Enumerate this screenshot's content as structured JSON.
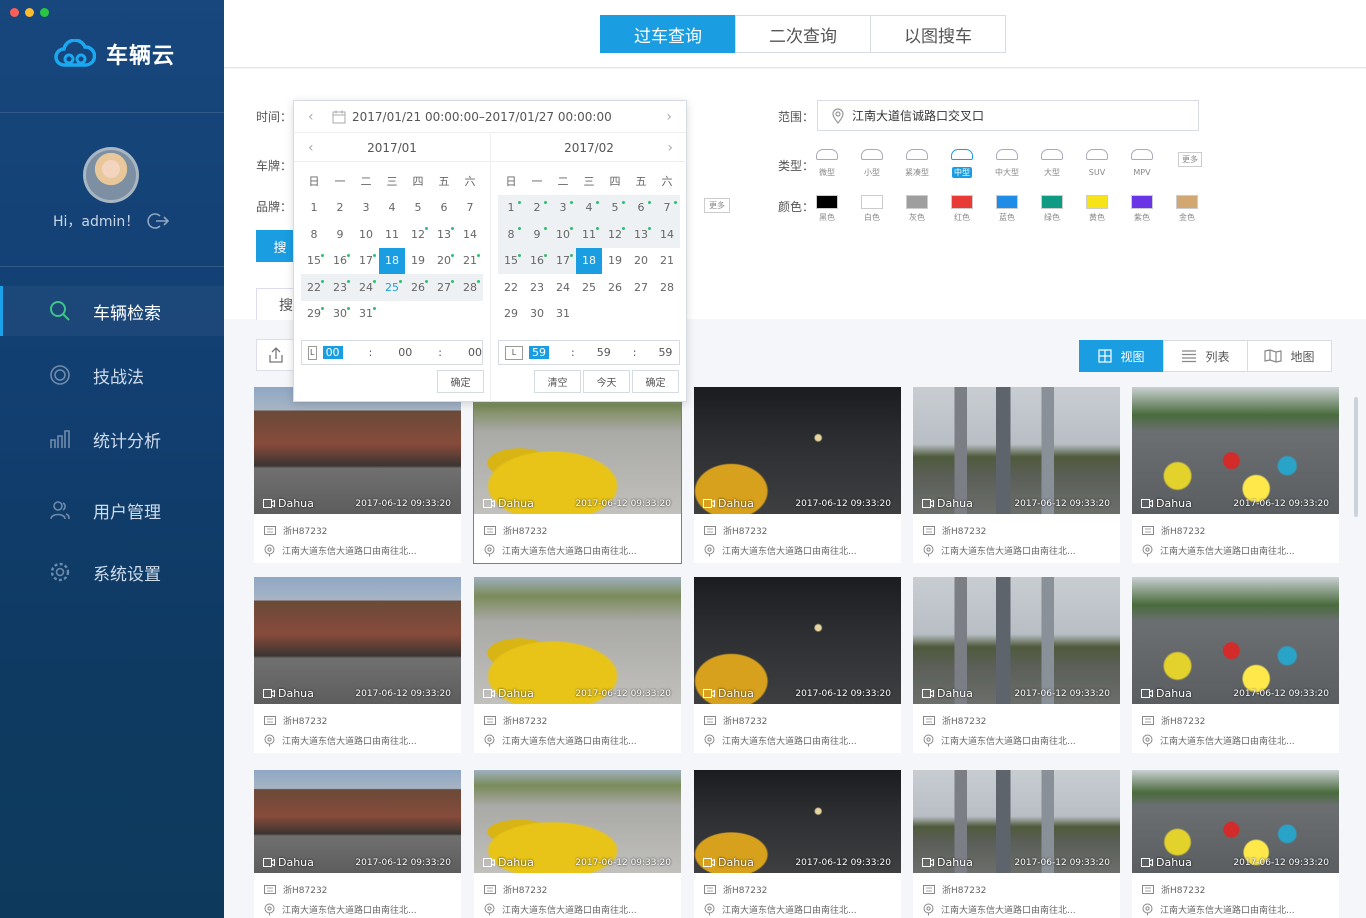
{
  "window": {
    "traffic_colors": [
      "#fc5f57",
      "#fdbc2e",
      "#28c840"
    ]
  },
  "app": {
    "logo_text": "车辆云"
  },
  "user": {
    "greeting": "Hi，admin！"
  },
  "sidebar": {
    "items": [
      {
        "label": "车辆检索",
        "icon": "search-icon",
        "active": true
      },
      {
        "label": "技战法",
        "icon": "target-icon",
        "active": false
      },
      {
        "label": "统计分析",
        "icon": "bar-chart-icon",
        "active": false
      },
      {
        "label": "用户管理",
        "icon": "users-icon",
        "active": false
      },
      {
        "label": "系统设置",
        "icon": "gear-icon",
        "active": false
      }
    ]
  },
  "top_tabs": [
    {
      "label": "过车查询",
      "active": true
    },
    {
      "label": "二次查询",
      "active": false
    },
    {
      "label": "以图搜车",
      "active": false
    }
  ],
  "filters": {
    "time_label": "时间：",
    "time_value": "2017/01/21 00:00:00–2017/01/27 00:00:00",
    "plate_label": "车牌：",
    "brand_label": "品牌：",
    "brand_more": "更多",
    "range_label": "范围：",
    "range_value": "江南大道信诚路口交叉口",
    "type_label": "类型：",
    "types": [
      "微型",
      "小型",
      "紧凑型",
      "中型",
      "中大型",
      "大型",
      "SUV",
      "MPV"
    ],
    "selected_type": "中型",
    "type_more": "更多",
    "color_label": "颜色：",
    "colors": [
      {
        "name": "黑色",
        "hex": "#000000"
      },
      {
        "name": "白色",
        "hex": "#ffffff"
      },
      {
        "name": "灰色",
        "hex": "#9e9e9e"
      },
      {
        "name": "红色",
        "hex": "#e83b35"
      },
      {
        "name": "蓝色",
        "hex": "#1f8de8"
      },
      {
        "name": "绿色",
        "hex": "#0f9a84"
      },
      {
        "name": "黄色",
        "hex": "#f7e31a"
      },
      {
        "name": "紫色",
        "hex": "#6a35e6"
      },
      {
        "name": "金色",
        "hex": "#d2a872"
      }
    ],
    "search_button": "搜",
    "sub_tab": "搜"
  },
  "view_tabs": [
    {
      "label": "视图",
      "icon": "grid-view-icon",
      "active": true
    },
    {
      "label": "列表",
      "icon": "list-view-icon",
      "active": false
    },
    {
      "label": "地图",
      "icon": "map-view-icon",
      "active": false
    }
  ],
  "datepicker": {
    "weekdays": [
      "日",
      "一",
      "二",
      "三",
      "四",
      "五",
      "六"
    ],
    "left": {
      "month": "2017/01",
      "days": [
        "1",
        "2",
        "3",
        "4",
        "5",
        "6",
        "7",
        "8",
        "9",
        "10",
        "11",
        "12",
        "13",
        "14",
        "15",
        "16",
        "17",
        "18",
        "19",
        "20",
        "21",
        "22",
        "23",
        "24",
        "25",
        "26",
        "27",
        "28",
        "29",
        "30",
        "31"
      ],
      "offset": 0,
      "selected": "18",
      "in_range": [
        "22",
        "23",
        "24",
        "25",
        "26",
        "27",
        "28"
      ],
      "dots": [
        "12",
        "13",
        "15",
        "16",
        "17",
        "20",
        "21",
        "22",
        "23",
        "24",
        "25",
        "26",
        "27",
        "28",
        "29",
        "30",
        "31"
      ],
      "today": "25",
      "time": {
        "h": "00",
        "m": "00",
        "s": "00"
      },
      "confirm": "确定"
    },
    "right": {
      "month": "2017/02",
      "days": [
        "1",
        "2",
        "3",
        "4",
        "5",
        "6",
        "7",
        "8",
        "9",
        "10",
        "11",
        "12",
        "13",
        "14",
        "15",
        "16",
        "17",
        "18",
        "19",
        "20",
        "21",
        "22",
        "23",
        "24",
        "25",
        "26",
        "27",
        "28",
        "29",
        "30",
        "31"
      ],
      "offset": 0,
      "selected": "18",
      "in_range": [
        "1",
        "2",
        "3",
        "4",
        "5",
        "6",
        "7",
        "8",
        "9",
        "10",
        "11",
        "12",
        "13",
        "14",
        "15",
        "16",
        "17"
      ],
      "dots": [
        "1",
        "2",
        "3",
        "4",
        "5",
        "6",
        "7",
        "8",
        "9",
        "10",
        "11",
        "12",
        "13",
        "15",
        "16",
        "17"
      ],
      "time": {
        "h": "59",
        "m": "59",
        "s": "59"
      },
      "clear": "清空",
      "today_btn": "今天",
      "confirm": "确定"
    }
  },
  "results": [
    {
      "brand": "Dahua",
      "time": "2017-06-12 09:33:20",
      "plate": "浙H87232",
      "location": "江南大道东信大道路口由南往北...",
      "scene": "street"
    },
    {
      "brand": "Dahua",
      "time": "2017-06-12 09:33:20",
      "plate": "浙H87232",
      "location": "江南大道东信大道路口由南往北...",
      "scene": "taxi"
    },
    {
      "brand": "Dahua",
      "time": "2017-06-12 09:33:20",
      "plate": "浙H87232",
      "location": "江南大道东信大道路口由南往北...",
      "scene": "night"
    },
    {
      "brand": "Dahua",
      "time": "2017-06-12 09:33:20",
      "plate": "浙H87232",
      "location": "江南大道东信大道路口由南往北...",
      "scene": "city"
    },
    {
      "brand": "Dahua",
      "time": "2017-06-12 09:33:20",
      "plate": "浙H87232",
      "location": "江南大道东信大道路口由南往北...",
      "scene": "traffic"
    },
    {
      "brand": "Dahua",
      "time": "2017-06-12 09:33:20",
      "plate": "浙H87232",
      "location": "江南大道东信大道路口由南往北...",
      "scene": "street"
    },
    {
      "brand": "Dahua",
      "time": "2017-06-12 09:33:20",
      "plate": "浙H87232",
      "location": "江南大道东信大道路口由南往北...",
      "scene": "taxi"
    },
    {
      "brand": "Dahua",
      "time": "2017-06-12 09:33:20",
      "plate": "浙H87232",
      "location": "江南大道东信大道路口由南往北...",
      "scene": "night"
    },
    {
      "brand": "Dahua",
      "time": "2017-06-12 09:33:20",
      "plate": "浙H87232",
      "location": "江南大道东信大道路口由南往北...",
      "scene": "city"
    },
    {
      "brand": "Dahua",
      "time": "2017-06-12 09:33:20",
      "plate": "浙H87232",
      "location": "江南大道东信大道路口由南往北...",
      "scene": "traffic"
    },
    {
      "brand": "Dahua",
      "time": "2017-06-12 09:33:20",
      "plate": "浙H87232",
      "location": "江南大道东信大道路口由南往北...",
      "scene": "street"
    },
    {
      "brand": "Dahua",
      "time": "2017-06-12 09:33:20",
      "plate": "浙H87232",
      "location": "江南大道东信大道路口由南往北...",
      "scene": "taxi"
    },
    {
      "brand": "Dahua",
      "time": "2017-06-12 09:33:20",
      "plate": "浙H87232",
      "location": "江南大道东信大道路口由南往北...",
      "scene": "night"
    },
    {
      "brand": "Dahua",
      "time": "2017-06-12 09:33:20",
      "plate": "浙H87232",
      "location": "江南大道东信大道路口由南往北...",
      "scene": "city"
    },
    {
      "brand": "Dahua",
      "time": "2017-06-12 09:33:20",
      "plate": "浙H87232",
      "location": "江南大道东信大道路口由南往北...",
      "scene": "traffic"
    }
  ]
}
